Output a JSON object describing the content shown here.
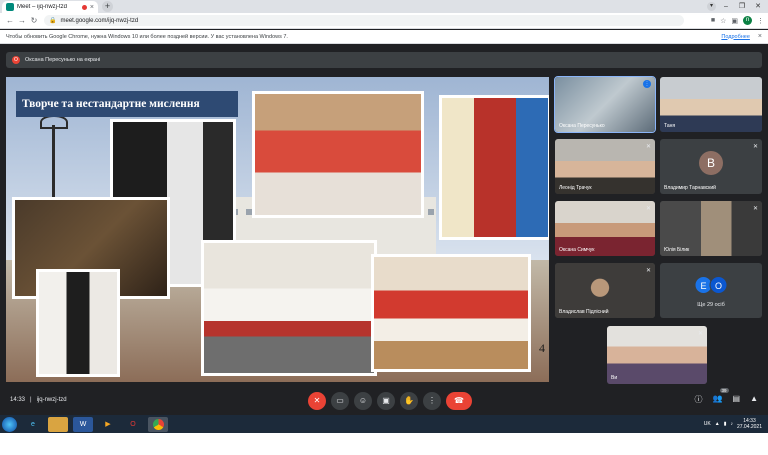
{
  "browser": {
    "tab_title": "Meet – ijq-nwzj-tzd",
    "tab_close": "×",
    "new_tab": "+",
    "url": "meet.google.com/ijq-nwzj-tzd",
    "profile_initial": "n"
  },
  "infobar": {
    "message": "Чтобы обновить Google Chrome, нужна Windows 10 или более поздней версии. У вас установлена Windows 7.",
    "more_link": "Подробнее",
    "close": "×"
  },
  "presenter": {
    "label": "Оксана Пересунько на екрані"
  },
  "slide": {
    "title": "Творче та нестандартне мислення",
    "page_number": "4"
  },
  "participants": [
    {
      "name": "Оксана Пересунько"
    },
    {
      "name": "Таня"
    },
    {
      "name": "Леонід Трачук"
    },
    {
      "name": "Владимир Тарнавский",
      "initial": "В"
    },
    {
      "name": "Оксана Симчук"
    },
    {
      "name": "Юлія Білик"
    },
    {
      "name": "Владислав Підлісний"
    },
    {
      "name": "Ще 29 осіб",
      "circles": [
        "E",
        "O"
      ]
    },
    {
      "name": "Ви"
    }
  ],
  "controls": {
    "time": "14:33",
    "separator": "|",
    "meeting_code": "ijq-nwzj-tzd",
    "participants_count": "39"
  },
  "taskbar": {
    "lang": "UK",
    "time": "14:33",
    "date": "27.04.2021"
  },
  "colors": {
    "meet_bg": "#202124",
    "tile_bg": "#3c4043",
    "hangup": "#ea4335",
    "title_banner": "#2e4a73"
  }
}
